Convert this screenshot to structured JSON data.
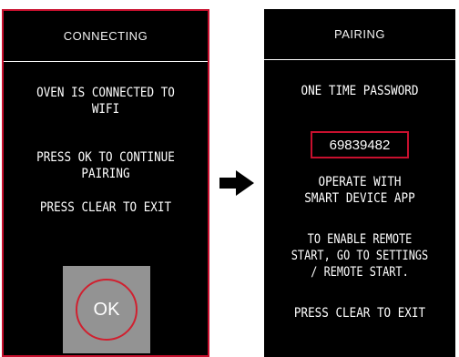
{
  "left_screen": {
    "title": "CONNECTING",
    "status_line1": "OVEN IS CONNECTED TO",
    "status_line2": "WIFI",
    "continue_line1": "PRESS OK TO CONTINUE",
    "continue_line2": "PAIRING",
    "exit_text": "PRESS CLEAR TO EXIT",
    "ok_label": "OK"
  },
  "transition_icon": "arrow-right-icon",
  "right_screen": {
    "title": "PAIRING",
    "otp_heading": "ONE TIME PASSWORD",
    "otp_value": "69839482",
    "app_line1": "OPERATE WITH",
    "app_line2": "SMART DEVICE APP",
    "remote_line1": "TO ENABLE REMOTE",
    "remote_line2": "START, GO TO SETTINGS",
    "remote_line3": "/ REMOTE START.",
    "exit_text": "PRESS CLEAR TO EXIT"
  },
  "colors": {
    "screen_background": "#000000",
    "accent_red": "#c8102e",
    "ok_pad_gray": "#939393",
    "text": "#ffffff"
  }
}
